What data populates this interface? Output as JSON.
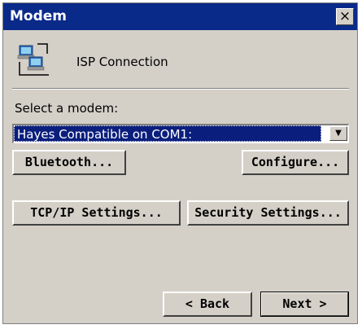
{
  "window": {
    "title": "Modem",
    "close_glyph": "×"
  },
  "header": {
    "icon": "isp-connection-icon",
    "label": "ISP Connection"
  },
  "modem_select": {
    "label": "Select a modem:",
    "selected": "Hayes Compatible on COM1:",
    "arrow_glyph": "▼"
  },
  "buttons": {
    "bluetooth": "Bluetooth...",
    "configure": "Configure...",
    "tcpip": "TCP/IP Settings...",
    "security": "Security Settings..."
  },
  "nav": {
    "back": "< Back",
    "next": "Next >"
  },
  "colors": {
    "titlebar": "#0a2a8a",
    "selection": "#0a1e7d",
    "face": "#d4d0c8"
  }
}
